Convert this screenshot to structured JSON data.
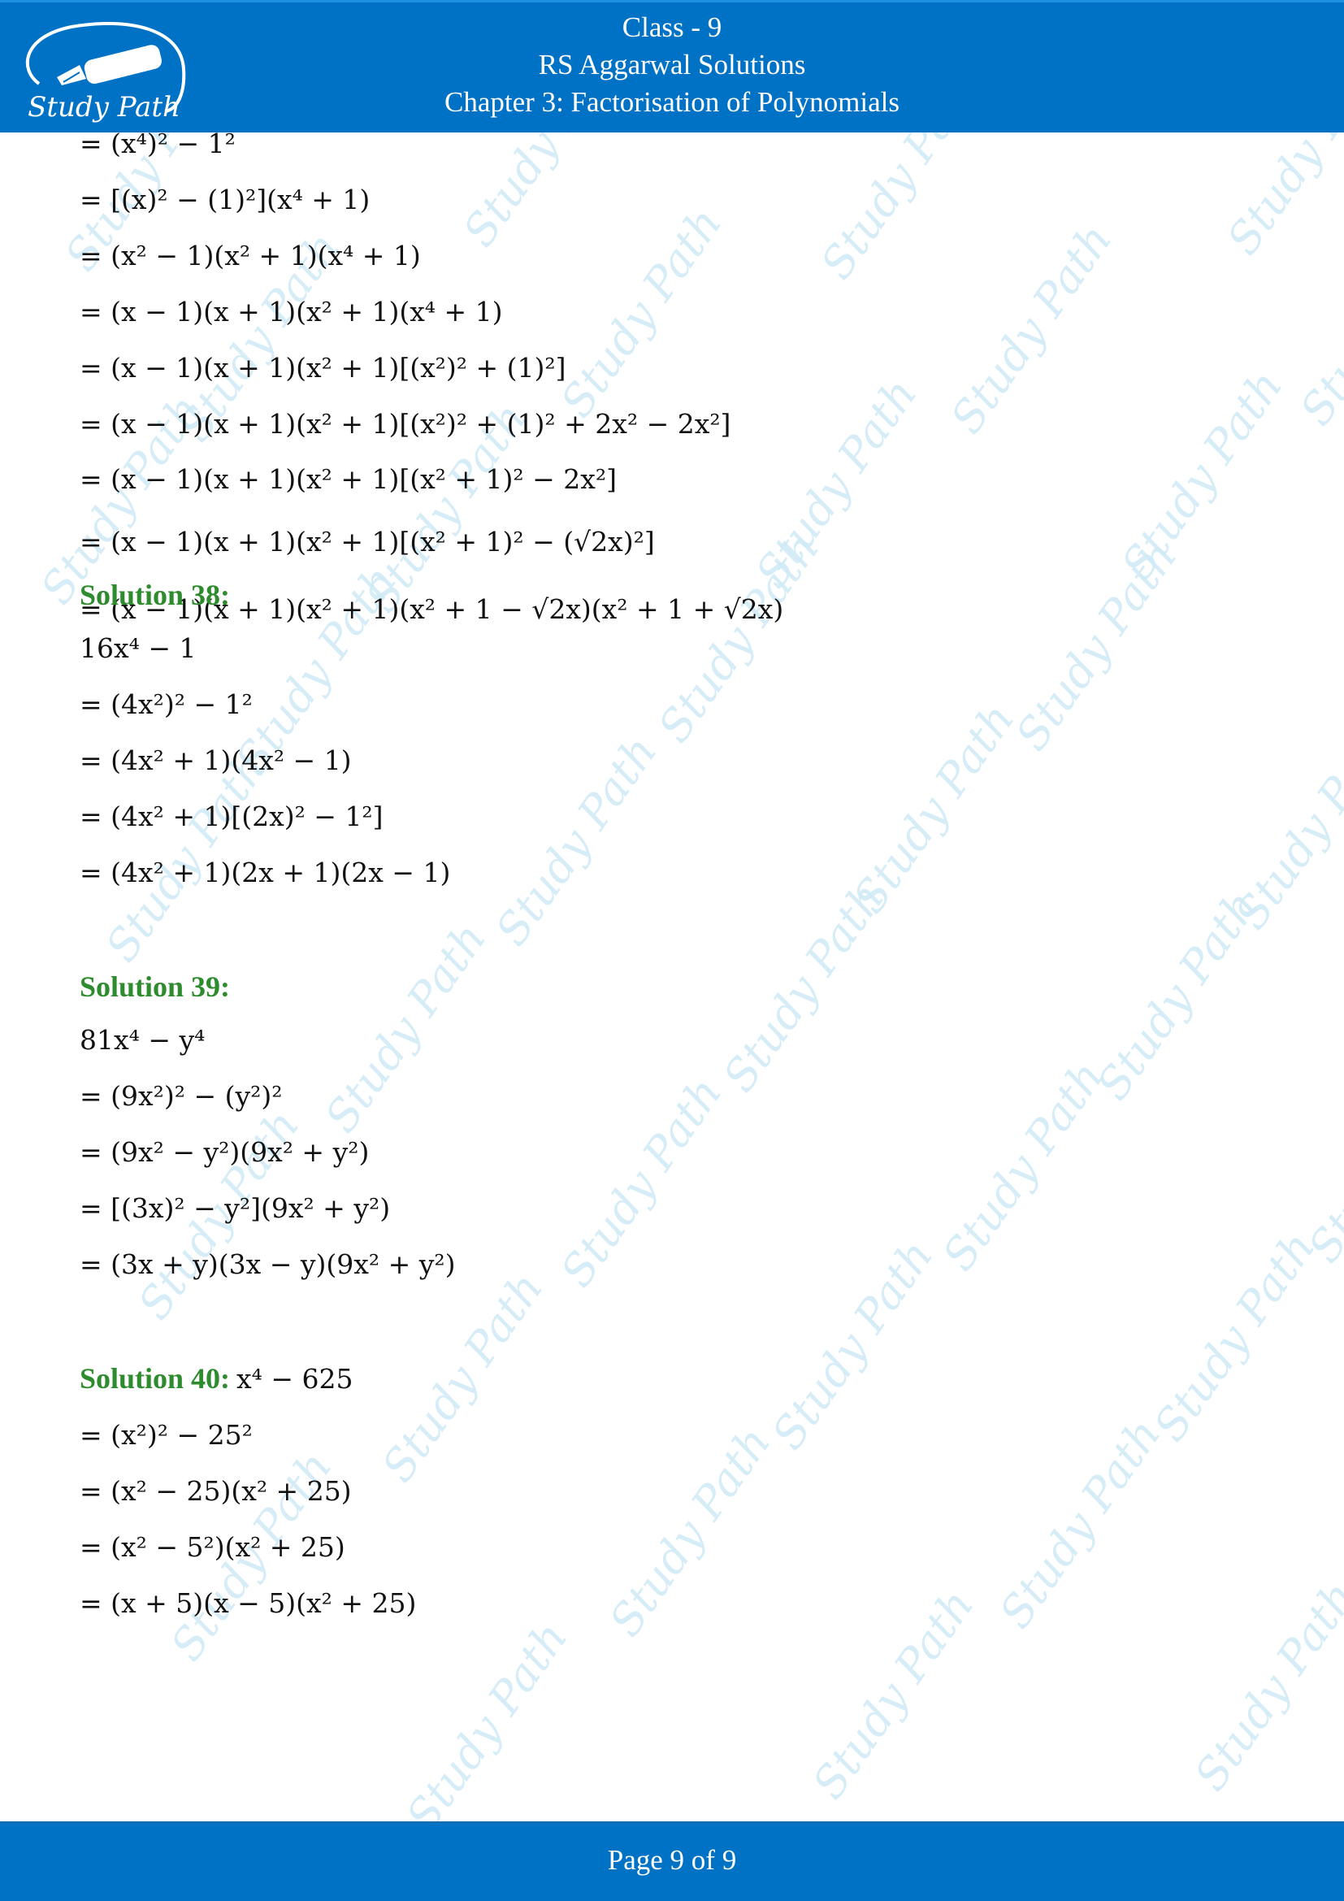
{
  "header": {
    "logo_text": "Study Path",
    "lines": [
      "Class - 9",
      "RS Aggarwal Solutions",
      "Chapter 3: Factorisation of Polynomials"
    ]
  },
  "watermark_text": "Study Path",
  "continuation": {
    "steps": [
      "= (x⁴)² − 1²",
      "= [(x)² − (1)²](x⁴ + 1)",
      "= (x² − 1)(x² + 1)(x⁴ + 1)",
      "= (x − 1)(x + 1)(x² + 1)(x⁴ + 1)",
      "= (x − 1)(x + 1)(x² + 1)[(x²)² + (1)²]",
      "= (x − 1)(x + 1)(x² + 1)[(x²)² + (1)² + 2x² − 2x²]",
      "= (x − 1)(x + 1)(x² + 1)[(x² + 1)² − 2x²]",
      "= (x − 1)(x + 1)(x² + 1)[(x² + 1)² − (√2x)²]",
      "= (x − 1)(x + 1)(x² + 1)(x² + 1 − √2x)(x² + 1 + √2x)"
    ]
  },
  "solutions": [
    {
      "title": "Solution 38:",
      "inline_expr": "",
      "steps": [
        "16x⁴ − 1",
        "= (4x²)² − 1²",
        "= (4x² + 1)(4x² − 1)",
        "= (4x² + 1)[(2x)² − 1²]",
        "= (4x² + 1)(2x + 1)(2x − 1)"
      ]
    },
    {
      "title": "Solution 39:",
      "inline_expr": "",
      "steps": [
        "81x⁴ − y⁴",
        "= (9x²)² − (y²)²",
        "= (9x² − y²)(9x² + y²)",
        "= [(3x)² − y²](9x² + y²)",
        "= (3x + y)(3x − y)(9x² + y²)"
      ]
    },
    {
      "title": "Solution 40:",
      "inline_expr": "x⁴ − 625",
      "steps": [
        "= (x²)² − 25²",
        "= (x² − 25)(x² + 25)",
        "= (x² − 5²)(x² + 25)",
        "= (x + 5)(x − 5)(x² + 25)"
      ]
    }
  ],
  "footer": {
    "page_label": "Page 9 of 9"
  },
  "colors": {
    "header_bg": "#0072c6",
    "solution_heading": "#2e8b2e",
    "watermark": "#cfeaf6"
  }
}
